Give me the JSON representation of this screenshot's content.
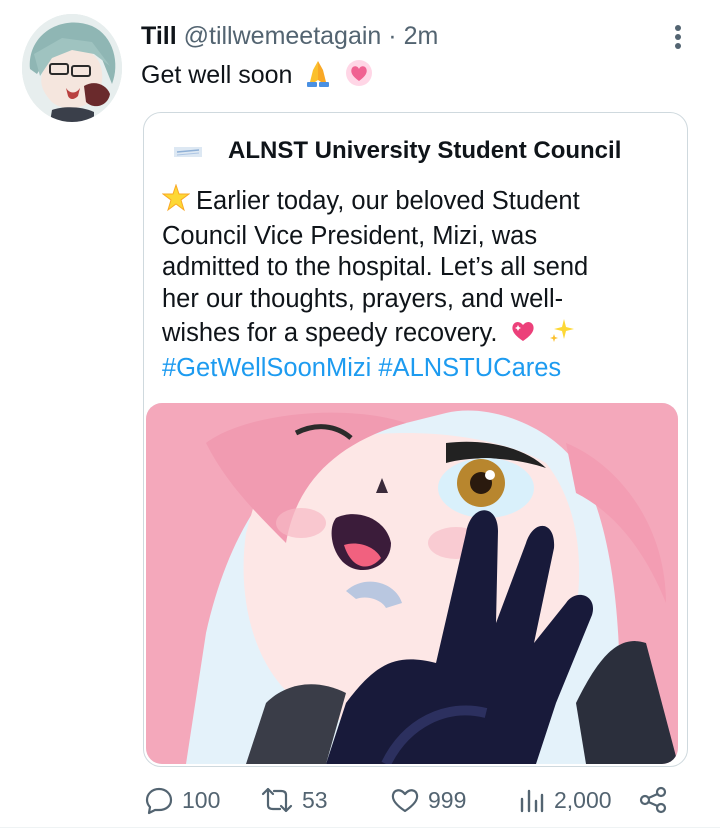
{
  "tweet": {
    "author_name": "Till",
    "author_handle": "@tillwemeetagain",
    "separator": "·",
    "time": "2m",
    "text": "Get well soon",
    "text_emojis": [
      "folded-hands-emoji",
      "pink-heart-emoji"
    ],
    "avatar_icon": "avatar-till-icon",
    "more_icon": "more-options-icon"
  },
  "quote": {
    "author_name": "ALNST University Student Council",
    "avatar_icon": "student-council-logo",
    "lines": [
      "Earlier today, our beloved Student",
      "Council Vice President, Mizi, was",
      "admitted to the hospital. Let’s all send",
      "her our thoughts, prayers, and well-",
      "wishes for a speedy recovery."
    ],
    "emojis": [
      "glowing-star-emoji",
      "sparkling-heart-emoji",
      "sparkles-emoji"
    ],
    "hashtags": [
      "#GetWellSoonMizi",
      "#ALNSTUCares"
    ],
    "media_icon": "mizi-illustration-image"
  },
  "actions": {
    "replies": "100",
    "retweets": "53",
    "likes": "999",
    "views": "2,000"
  },
  "colors": {
    "link": "#1d9bf0",
    "secondary_text": "#536471",
    "border": "#cfd9de"
  }
}
